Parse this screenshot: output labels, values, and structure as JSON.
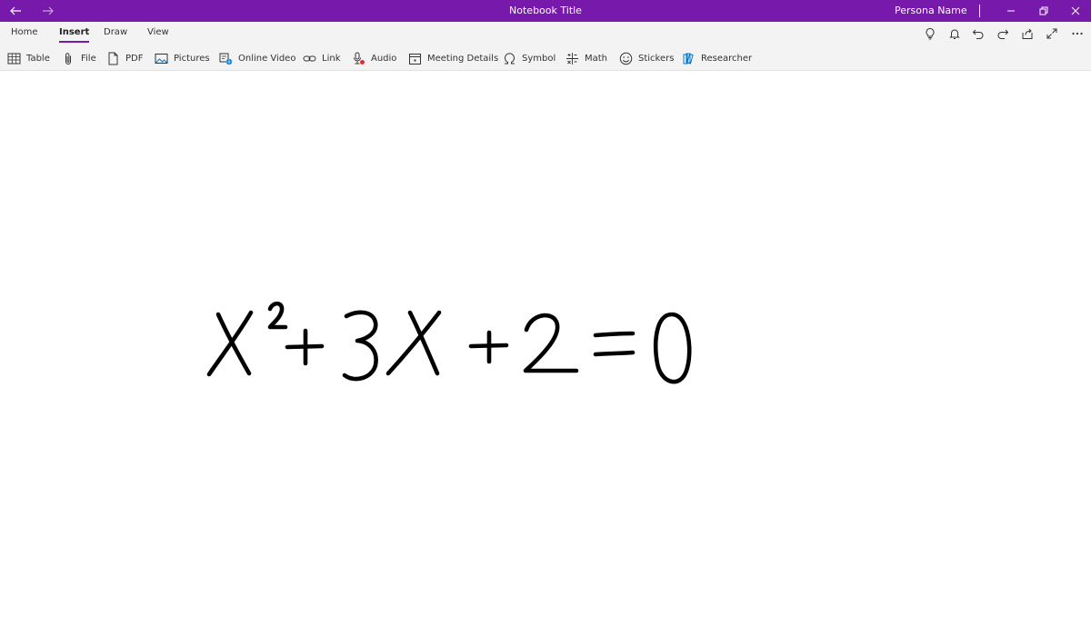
{
  "titlebar": {
    "title": "Notebook Title",
    "persona": "Persona Name",
    "color": "#7719aa"
  },
  "tabs": [
    {
      "label": "Home"
    },
    {
      "label": "Insert",
      "active": true
    },
    {
      "label": "Draw"
    },
    {
      "label": "View"
    }
  ],
  "toolbar": {
    "table": "Table",
    "file": "File",
    "pdf": "PDF",
    "pictures": "Pictures",
    "online_video": "Online Video",
    "link": "Link",
    "audio": "Audio",
    "meeting_details": "Meeting Details",
    "symbol": "Symbol",
    "math": "Math",
    "stickers": "Stickers",
    "researcher": "Researcher"
  },
  "right_icons": [
    "lightbulb-icon",
    "bell-icon",
    "undo-icon",
    "redo-icon",
    "share-icon",
    "expand-icon",
    "more-icon"
  ],
  "ink": {
    "equation": "X²+3X+2=0"
  }
}
